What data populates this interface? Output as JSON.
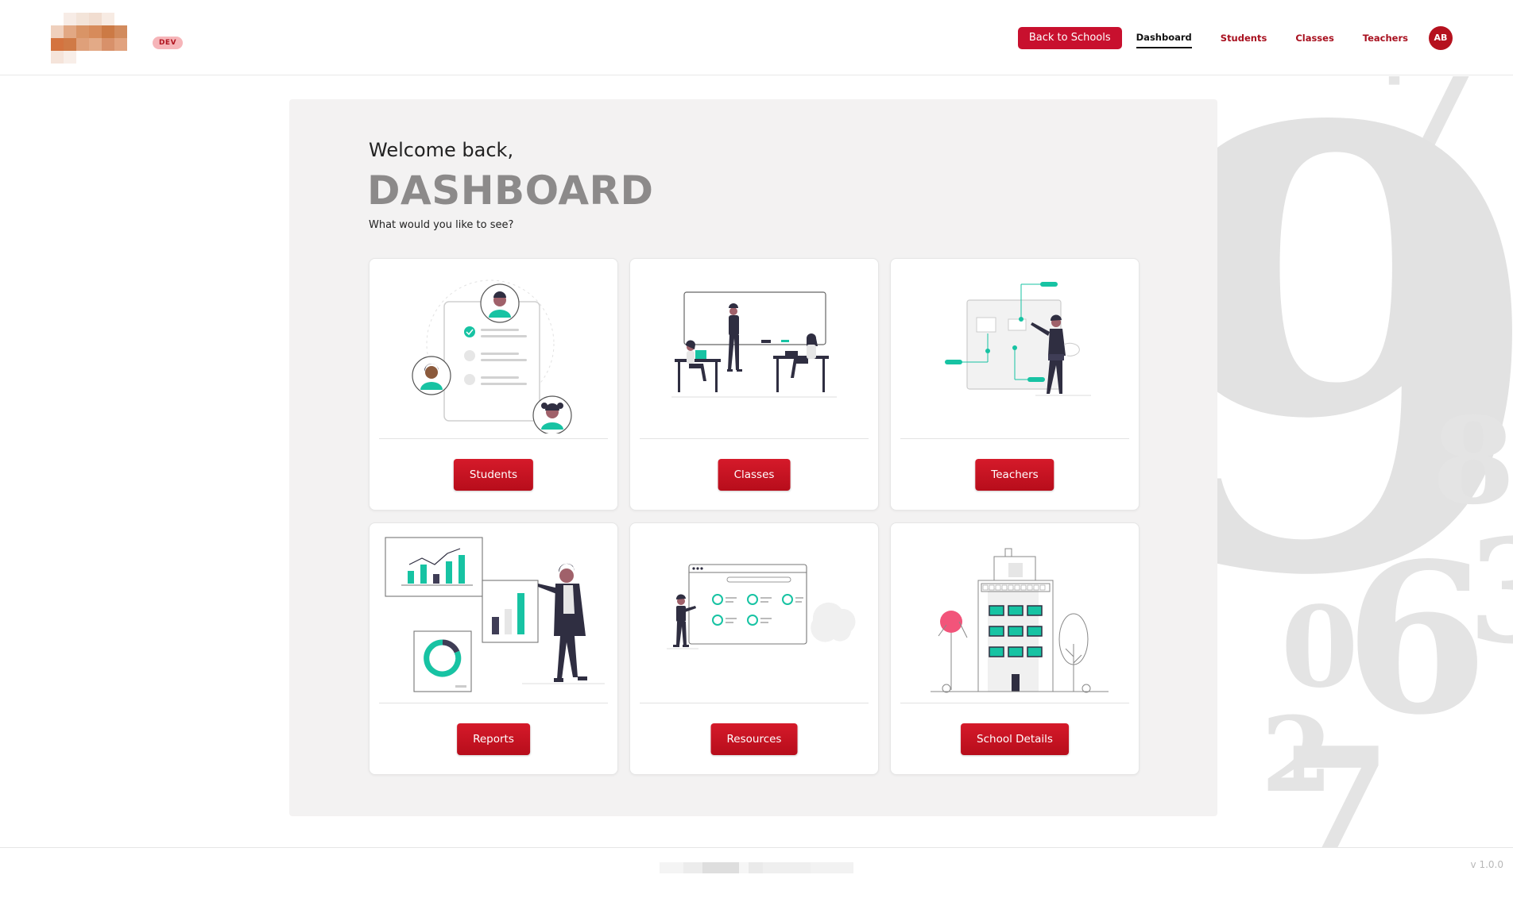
{
  "header": {
    "env_badge": "DEV",
    "back_button": "Back to Schools",
    "nav": [
      "Dashboard",
      "Students",
      "Classes",
      "Teachers"
    ],
    "active_nav": "Dashboard",
    "avatar_initials": "AB"
  },
  "main": {
    "greeting": "Welcome back,",
    "title": "DASHBOARD",
    "subtitle": "What would you like to see?",
    "cards": [
      {
        "label": "Students",
        "illustration": "students-illustration"
      },
      {
        "label": "Classes",
        "illustration": "classroom-illustration"
      },
      {
        "label": "Teachers",
        "illustration": "teacher-illustration"
      },
      {
        "label": "Reports",
        "illustration": "reports-illustration"
      },
      {
        "label": "Resources",
        "illustration": "resources-illustration"
      },
      {
        "label": "School Details",
        "illustration": "school-building-illustration"
      }
    ]
  },
  "footer": {
    "version": "v 1.0.0"
  },
  "colors": {
    "brand_red": "#c3111f",
    "accent_teal": "#17c3a3",
    "panel_bg": "#f3f2f2",
    "title_gray": "#8c8a8a"
  },
  "background_numerals": [
    "7",
    "9",
    "8",
    "0",
    "6",
    "3",
    "2",
    "7"
  ]
}
